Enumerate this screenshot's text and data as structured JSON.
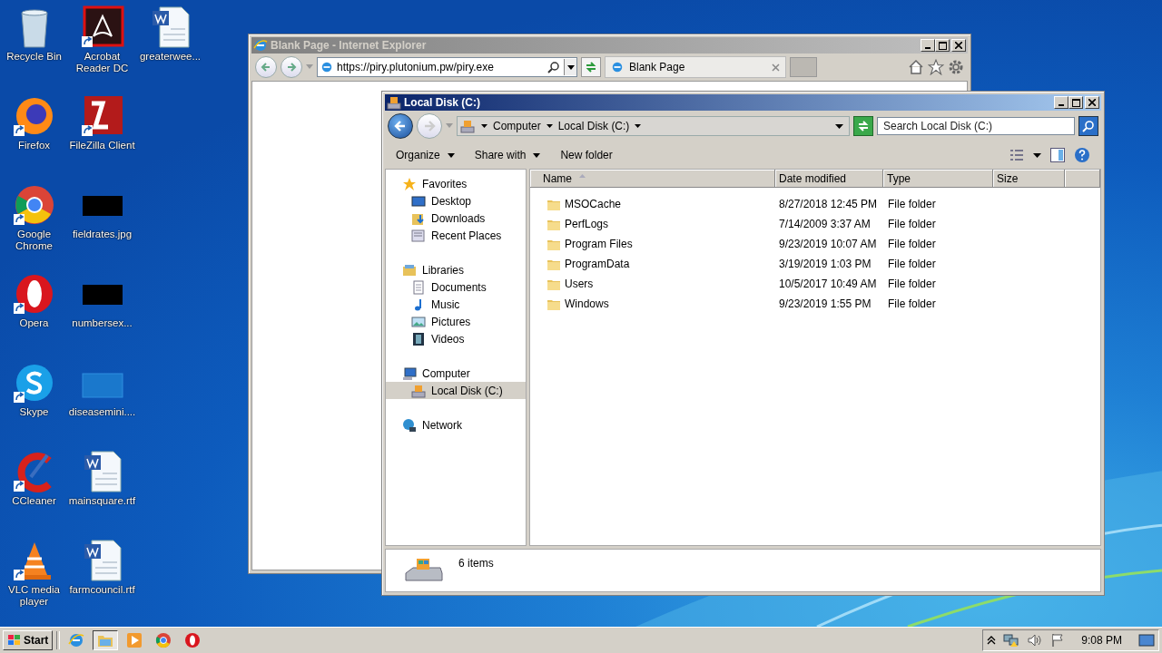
{
  "desktop": {
    "columns": [
      [
        {
          "label": "Recycle Bin",
          "kind": "recycle",
          "shortcut": false
        },
        {
          "label": "Firefox",
          "kind": "firefox",
          "shortcut": true
        },
        {
          "label": "Google Chrome",
          "kind": "chrome",
          "shortcut": true
        },
        {
          "label": "Opera",
          "kind": "opera",
          "shortcut": true
        },
        {
          "label": "Skype",
          "kind": "skype",
          "shortcut": true
        },
        {
          "label": "CCleaner",
          "kind": "ccleaner",
          "shortcut": true
        },
        {
          "label": "VLC media player",
          "kind": "vlc",
          "shortcut": true
        }
      ],
      [
        {
          "label": "Acrobat Reader DC",
          "kind": "acrobat",
          "shortcut": true
        },
        {
          "label": "FileZilla Client",
          "kind": "filezilla",
          "shortcut": true
        },
        {
          "label": "fieldrates.jpg",
          "kind": "dark",
          "shortcut": false
        },
        {
          "label": "numbersex...",
          "kind": "dark",
          "shortcut": false
        },
        {
          "label": "diseasemini....",
          "kind": "blank",
          "shortcut": false
        },
        {
          "label": "mainsquare.rtf",
          "kind": "word",
          "shortcut": false
        },
        {
          "label": "farmcouncil.rtf",
          "kind": "word",
          "shortcut": false
        }
      ],
      [
        {
          "label": "greaterwee...",
          "kind": "word",
          "shortcut": false
        }
      ]
    ]
  },
  "browser": {
    "title": "Blank Page - Internet Explorer",
    "active": false,
    "address": "https://piry.plutonium.pw/piry.exe",
    "tabs": [
      {
        "label": "Blank Page",
        "selected": true
      }
    ]
  },
  "explorer": {
    "title": "Local Disk (C:)",
    "active": true,
    "breadcrumb": [
      "Computer",
      "Local Disk (C:)"
    ],
    "search": {
      "placeholder": "Search Local Disk (C:)"
    },
    "toolbar": [
      {
        "label": "Organize",
        "menu": true
      },
      {
        "label": "Share with",
        "menu": true
      },
      {
        "label": "New folder",
        "menu": false
      }
    ],
    "navigation": [
      {
        "label": "Favorites",
        "kind": "star",
        "selected": false,
        "children": [
          {
            "label": "Desktop",
            "kind": "desktop",
            "selected": false
          },
          {
            "label": "Downloads",
            "kind": "downloads",
            "selected": false
          },
          {
            "label": "Recent Places",
            "kind": "recent",
            "selected": false
          }
        ]
      },
      {
        "label": "Libraries",
        "kind": "library",
        "selected": false,
        "children": [
          {
            "label": "Documents",
            "kind": "document",
            "selected": false
          },
          {
            "label": "Music",
            "kind": "music",
            "selected": false
          },
          {
            "label": "Pictures",
            "kind": "pictures",
            "selected": false
          },
          {
            "label": "Videos",
            "kind": "videos",
            "selected": false
          }
        ]
      },
      {
        "label": "Computer",
        "kind": "computer",
        "selected": false,
        "children": [
          {
            "label": "Local Disk (C:)",
            "kind": "disk",
            "selected": true
          }
        ]
      },
      {
        "label": "Network",
        "kind": "network",
        "selected": false
      }
    ],
    "columns": [
      {
        "label": "Name",
        "sorted": true
      },
      {
        "label": "Date modified",
        "sorted": false
      },
      {
        "label": "Type",
        "sorted": false
      },
      {
        "label": "Size",
        "sorted": false
      }
    ],
    "rows": [
      {
        "name": "MSOCache",
        "date": "8/27/2018 12:45 PM",
        "type": "File folder"
      },
      {
        "name": "PerfLogs",
        "date": "7/14/2009 3:37 AM",
        "type": "File folder"
      },
      {
        "name": "Program Files",
        "date": "9/23/2019 10:07 AM",
        "type": "File folder"
      },
      {
        "name": "ProgramData",
        "date": "3/19/2019 1:03 PM",
        "type": "File folder"
      },
      {
        "name": "Users",
        "date": "10/5/2017 10:49 AM",
        "type": "File folder"
      },
      {
        "name": "Windows",
        "date": "9/23/2019 1:55 PM",
        "type": "File folder"
      }
    ],
    "status": "6 items"
  },
  "taskbar": {
    "start": "Start",
    "items": [
      {
        "kind": "ie",
        "selected": false
      },
      {
        "kind": "explorer",
        "selected": true
      },
      {
        "kind": "media",
        "selected": false
      },
      {
        "kind": "chrome",
        "selected": false
      },
      {
        "kind": "opera",
        "selected": false
      }
    ],
    "clock": "9:08 PM"
  }
}
